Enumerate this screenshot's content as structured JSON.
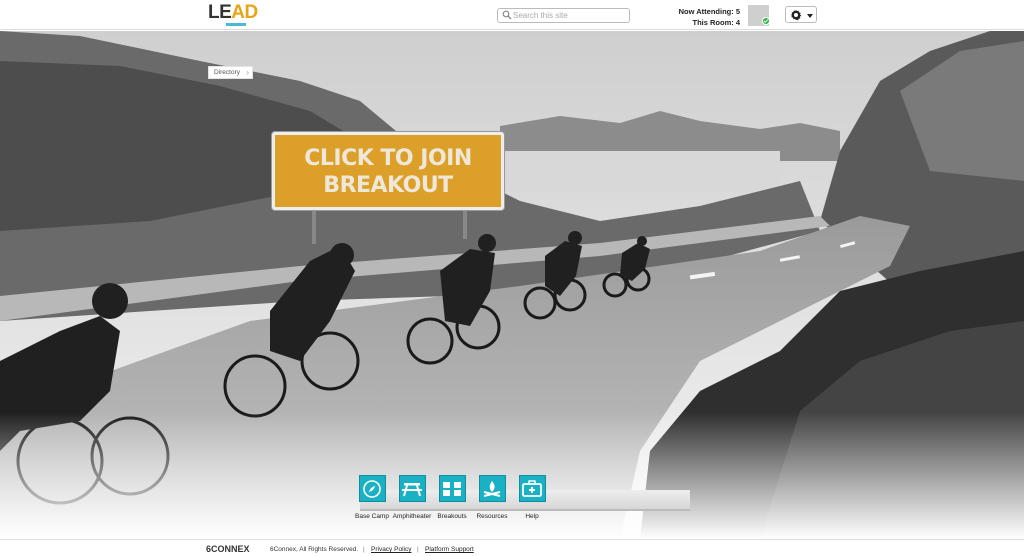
{
  "header": {
    "logo_left": "LE",
    "logo_right": "AD",
    "search_placeholder": "Search this site",
    "now_attending_label": "Now Attending: 5",
    "this_room_label": "This Room: 4"
  },
  "breadcrumb": {
    "label": "Directory"
  },
  "hero": {
    "sign_line1": "CLICK TO JOIN",
    "sign_line2": "BREAKOUT"
  },
  "nav": {
    "items": [
      {
        "label": "Base Camp",
        "icon": "compass-icon"
      },
      {
        "label": "Amphitheater",
        "icon": "picnic-table-icon"
      },
      {
        "label": "Breakouts",
        "icon": "breakout-tables-icon"
      },
      {
        "label": "Resources",
        "icon": "campfire-icon"
      },
      {
        "label": "Help",
        "icon": "first-aid-kit-icon"
      }
    ]
  },
  "footer": {
    "brand": "6CONNEX",
    "copyright": "6Connex, All Rights Reserved.",
    "separator": "|",
    "privacy": "Privacy Policy",
    "support": "Platform Support"
  },
  "colors": {
    "accent": "#1ab1c4",
    "sign": "#dca02a",
    "logo_accent": "#e8a317",
    "online": "#2fb344"
  }
}
